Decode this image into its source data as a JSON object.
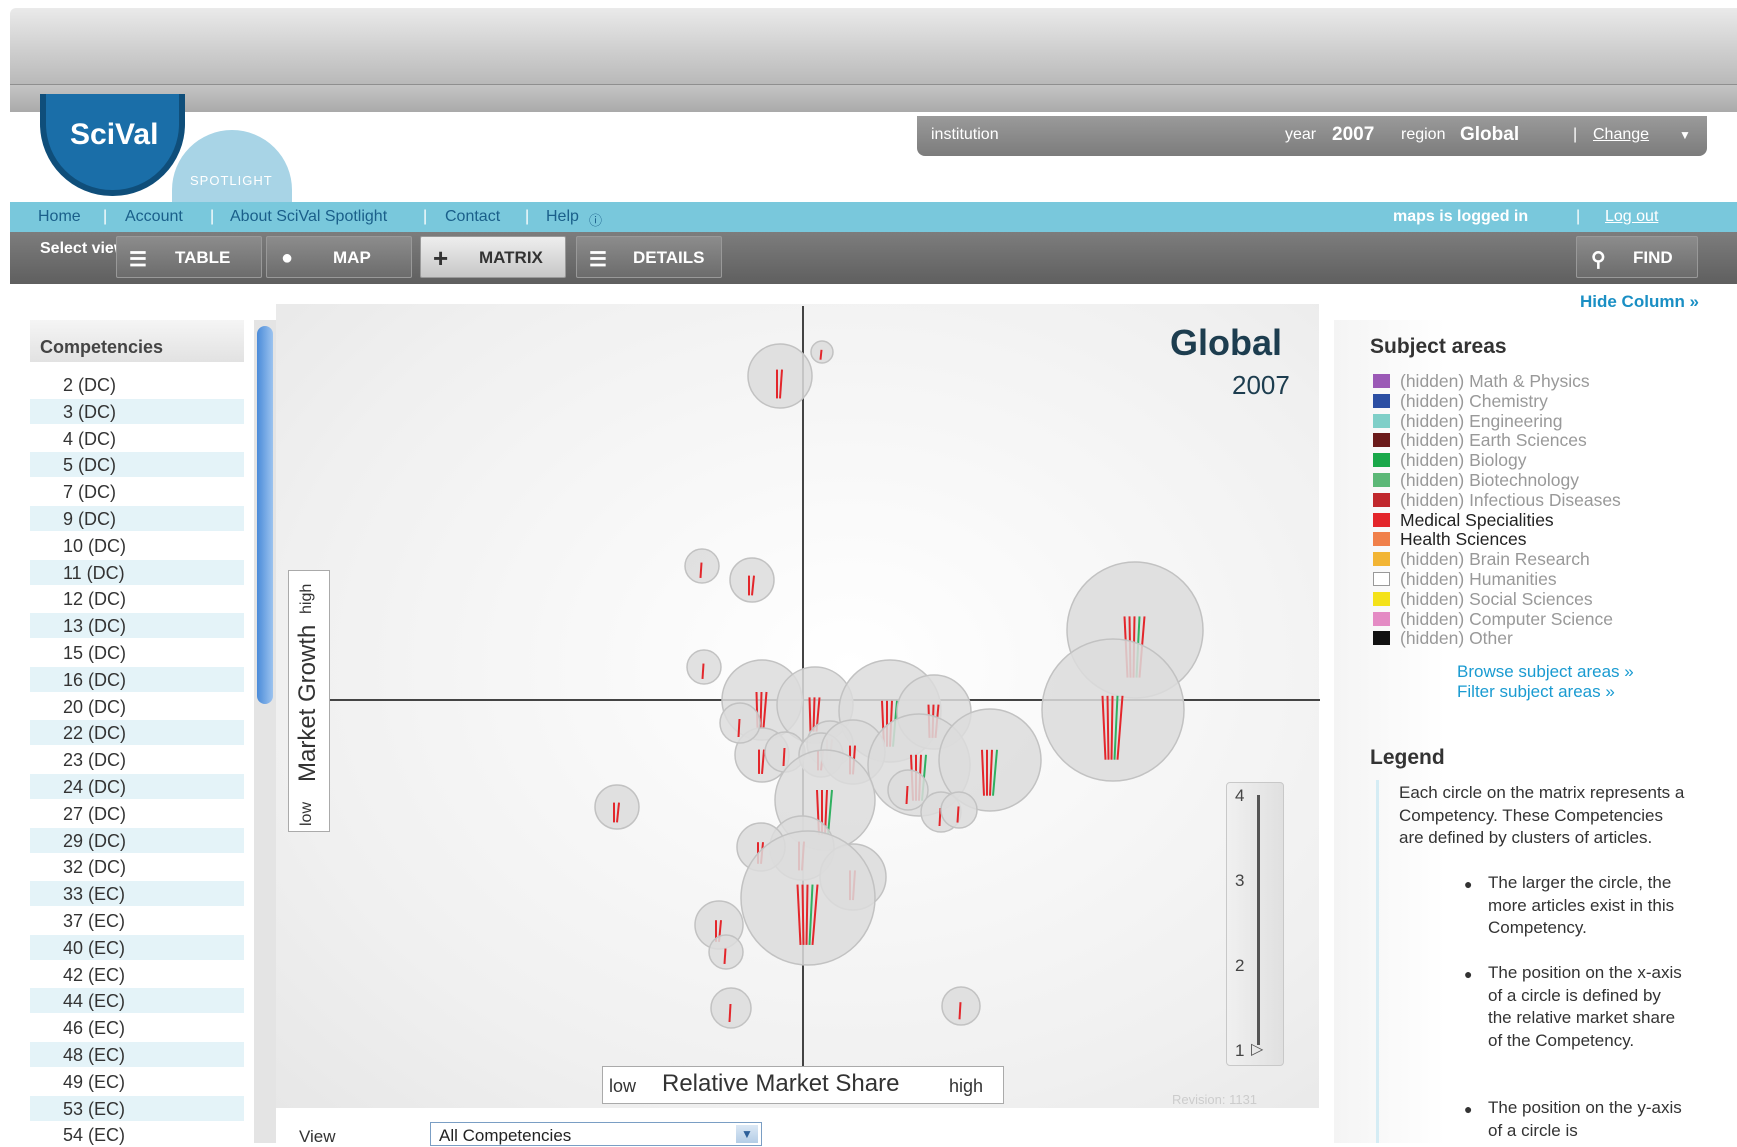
{
  "header": {
    "logo_text": "SciVal",
    "logo_sub": "SPOTLIGHT",
    "institution_label": "institution",
    "year_label": "year",
    "year_value": "2007",
    "region_label": "region",
    "region_value": "Global",
    "change_label": "Change"
  },
  "nav": {
    "items": [
      "Home",
      "Account",
      "About SciVal Spotlight",
      "Contact",
      "Help"
    ],
    "logged_in": "maps is logged in",
    "logout": "Log out"
  },
  "toolbar": {
    "select_view": "Select view",
    "table": "TABLE",
    "map": "MAP",
    "matrix": "MATRIX",
    "details": "DETAILS",
    "find": "FIND"
  },
  "hide_column": "Hide Column »",
  "competencies": {
    "title": "Competencies",
    "items": [
      "2 (DC)",
      "3 (DC)",
      "4 (DC)",
      "5 (DC)",
      "7 (DC)",
      "9 (DC)",
      "10 (DC)",
      "11 (DC)",
      "12 (DC)",
      "13 (DC)",
      "15 (DC)",
      "16 (DC)",
      "20 (DC)",
      "22 (DC)",
      "23 (DC)",
      "24 (DC)",
      "27 (DC)",
      "29 (DC)",
      "32 (DC)",
      "33 (EC)",
      "37 (EC)",
      "40 (EC)",
      "42 (EC)",
      "44 (EC)",
      "46 (EC)",
      "48 (EC)",
      "49 (EC)",
      "53 (EC)",
      "54 (EC)"
    ]
  },
  "matrix": {
    "title": "Global",
    "year": "2007",
    "y_axis": {
      "low": "low",
      "label": "Market Growth",
      "high": "high"
    },
    "x_axis": {
      "low": "low",
      "label": "Relative Market Share",
      "high": "high"
    },
    "slider_ticks": [
      "4",
      "3",
      "2",
      "1"
    ],
    "revision": "Revision: 1131"
  },
  "view": {
    "label": "View",
    "selected": "All Competencies"
  },
  "subject_areas": {
    "title": "Subject areas",
    "items": [
      {
        "label": "(hidden) Math & Physics",
        "color": "#9b59b6",
        "hidden": true
      },
      {
        "label": "(hidden) Chemistry",
        "color": "#2c4fa3",
        "hidden": true
      },
      {
        "label": "(hidden) Engineering",
        "color": "#7fcfc8",
        "hidden": true
      },
      {
        "label": "(hidden) Earth Sciences",
        "color": "#6b1b1b",
        "hidden": true
      },
      {
        "label": "(hidden) Biology",
        "color": "#1aa84a",
        "hidden": true
      },
      {
        "label": "(hidden) Biotechnology",
        "color": "#5cb877",
        "hidden": true
      },
      {
        "label": "(hidden) Infectious Diseases",
        "color": "#c0282d",
        "hidden": true
      },
      {
        "label": "Medical Specialities",
        "color": "#e3262b",
        "hidden": false
      },
      {
        "label": "Health Sciences",
        "color": "#f0804a",
        "hidden": false
      },
      {
        "label": "(hidden) Brain Research",
        "color": "#f2b535",
        "hidden": true
      },
      {
        "label": "(hidden) Humanities",
        "color": "#ffffff",
        "hidden": true
      },
      {
        "label": "(hidden) Social Sciences",
        "color": "#f4e21a",
        "hidden": true
      },
      {
        "label": "(hidden) Computer Science",
        "color": "#e48bc4",
        "hidden": true
      },
      {
        "label": "(hidden) Other",
        "color": "#111111",
        "hidden": true
      }
    ],
    "browse": "Browse subject areas »",
    "filter": "Filter subject areas »"
  },
  "legend": {
    "title": "Legend",
    "intro": "Each circle on the matrix represents a Competency. These Competencies are defined by clusters of articles.",
    "bullets": [
      "The larger the circle, the more articles exist in this Competency.",
      "The position on the x-axis of a circle is defined by the relative market share of the Competency.",
      "The position on the y-axis of a circle is"
    ]
  }
}
